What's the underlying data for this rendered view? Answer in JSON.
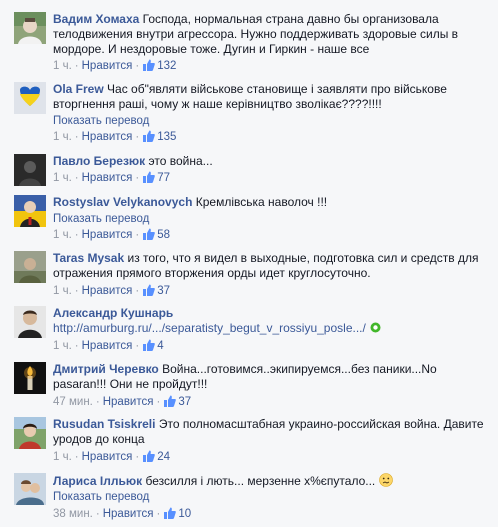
{
  "comments": [
    {
      "author": "Вадим Хомаха",
      "text": "Господа, нормальная страна давно бы организовала телодвижения внутри агрессора. Нужно поддерживать здоровые силы в мордоре. И нездоровые тоже. Дугин и Гиркин - наше все",
      "time": "1 ч.",
      "like_label": "Нравится",
      "likes": "132"
    },
    {
      "author": "Ola Frew",
      "text": "Час об\"являти військове становище і заявляти про військове вторгнення раші, чому ж наше керівництво зволікає????!!!!",
      "translate": "Показать перевод",
      "time": "1 ч.",
      "like_label": "Нравится",
      "likes": "135"
    },
    {
      "author": "Павло Березюк",
      "text": "это война...",
      "time": "1 ч.",
      "like_label": "Нравится",
      "likes": "77"
    },
    {
      "author": "Rostyslav Velykanovych",
      "text": "Кремлівська наволоч !!!",
      "translate": "Показать перевод",
      "time": "1 ч.",
      "like_label": "Нравится",
      "likes": "58"
    },
    {
      "author": "Taras Mysak",
      "text": "из того, что я видел в выходные, подготовка сил и средств для отражения прямого вторжения орды идет круглосуточно.",
      "time": "1 ч.",
      "like_label": "Нравится",
      "likes": "37"
    },
    {
      "author": "Александр Кушнарь",
      "link": "http://amurburg.ru/.../separatisty_begut_v_rossiyu_posle.../",
      "time": "1 ч.",
      "like_label": "Нравится",
      "likes": "4"
    },
    {
      "author": "Дмитрий Черевко",
      "text": "Война...готовимся..экипируемся...без паники...No pasaran!!! Они не пройдут!!!",
      "time": "47 мин.",
      "like_label": "Нравится",
      "likes": "37"
    },
    {
      "author": "Rusudan Tsiskreli",
      "text": "Это полномасштабная украино-российская война. Давите уродов до конца",
      "time": "1 ч.",
      "like_label": "Нравится",
      "likes": "24"
    },
    {
      "author": "Лариса Ілльюк",
      "text": "безсилля і лють... мерзенне х%єпутало...",
      "translate": "Показать перевод",
      "time": "38 мин.",
      "like_label": "Нравится",
      "likes": "10"
    }
  ],
  "colors": {
    "link": "#3b5998",
    "meta": "#9197a3",
    "text": "#141823",
    "background": "#f6f7f9"
  },
  "icons": [
    "thumbs-up-icon",
    "external-link-icon",
    "confused-emoji-icon"
  ]
}
